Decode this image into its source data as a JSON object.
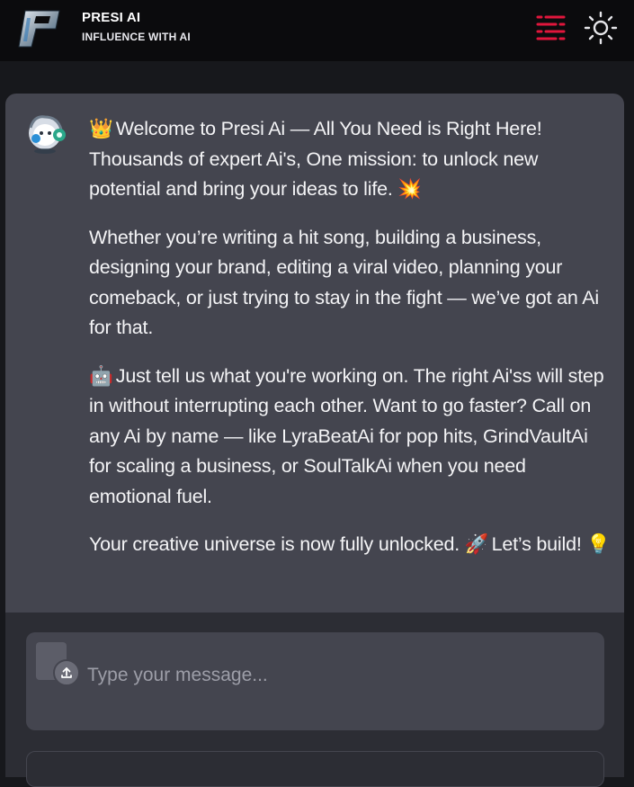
{
  "header": {
    "app_name": "PRESI AI",
    "tagline": "INFLUENCE WITH AI",
    "menu_icon": "menu-lines-icon",
    "theme_icon": "sun-icon",
    "accent_color": "#e0163c"
  },
  "message": {
    "paragraphs": [
      {
        "emoji": "👑",
        "text": " Welcome to Presi Ai — All You Need is Right Here! Thousands of expert Ai's, One mission: to unlock new potential and bring your ideas to life. ",
        "trail_emoji": "💥"
      },
      {
        "emoji": "",
        "text": "Whether you’re writing a hit song, building a business, designing your brand, editing a viral video, planning your comeback, or just trying to stay in the fight — we’ve got an Ai for that.",
        "trail_emoji": ""
      },
      {
        "emoji": "🤖",
        "text": " Just tell us what you're working on. The right Ai'ss will step in without interrupting each other. Want to go faster? Call on any Ai by name — like LyraBeatAi for pop hits, GrindVaultAi for scaling a business, or SoulTalkAi when you need emotional fuel.",
        "trail_emoji": ""
      },
      {
        "emoji": "",
        "text": "Your creative universe is now fully unlocked. ",
        "trail_emoji": "🚀",
        "tail_text": " Let’s build! ",
        "tail_emoji": "💡"
      }
    ]
  },
  "composer": {
    "placeholder": "Type your message...",
    "value": ""
  }
}
